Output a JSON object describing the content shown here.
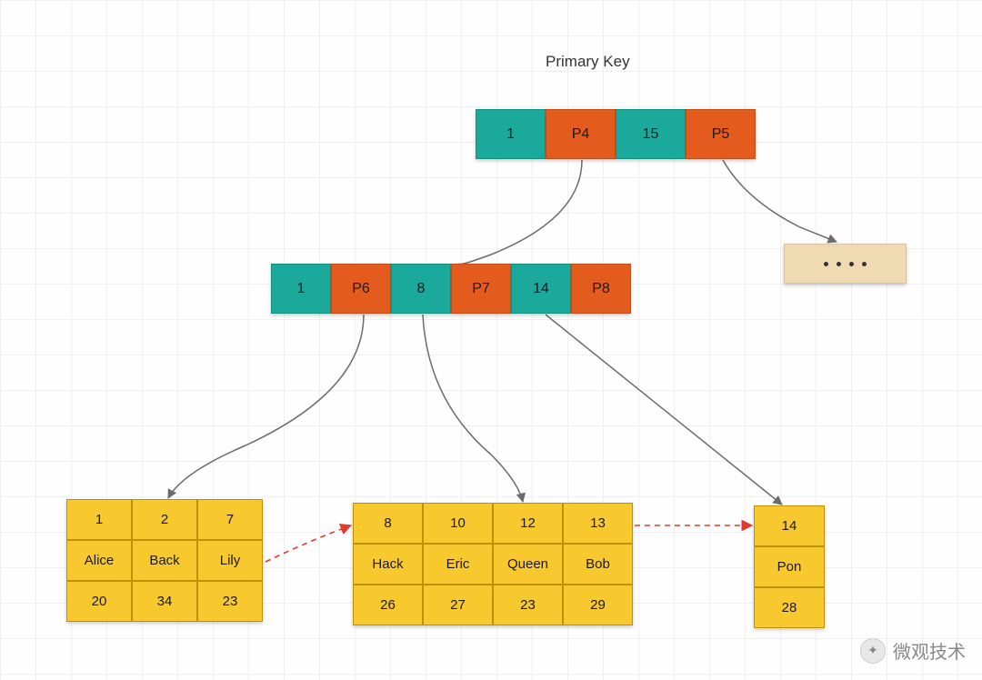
{
  "title": "Primary Key",
  "colors": {
    "teal": "#1aa99a",
    "orange": "#e45b1e",
    "yellow": "#f7c92f",
    "tan": "#f0dab2",
    "arrow_solid": "#6b6b6b",
    "arrow_dashed": "#e03a2a"
  },
  "root_node": {
    "cells": [
      {
        "value": "1",
        "color": "teal"
      },
      {
        "value": "P4",
        "color": "orange"
      },
      {
        "value": "15",
        "color": "teal"
      },
      {
        "value": "P5",
        "color": "orange"
      }
    ]
  },
  "internal_node": {
    "cells": [
      {
        "value": "1",
        "color": "teal"
      },
      {
        "value": "P6",
        "color": "orange"
      },
      {
        "value": "8",
        "color": "teal"
      },
      {
        "value": "P7",
        "color": "orange"
      },
      {
        "value": "14",
        "color": "teal"
      },
      {
        "value": "P8",
        "color": "orange"
      }
    ]
  },
  "ellipsis_box": {
    "dot_count": 4,
    "color": "tan"
  },
  "leaves": [
    {
      "id": "leaf1",
      "columns": 3,
      "rows": [
        [
          "1",
          "2",
          "7"
        ],
        [
          "Alice",
          "Back",
          "Lily"
        ],
        [
          "20",
          "34",
          "23"
        ]
      ]
    },
    {
      "id": "leaf2",
      "columns": 4,
      "rows": [
        [
          "8",
          "10",
          "12",
          "13"
        ],
        [
          "Hack",
          "Eric",
          "Queen",
          "Bob"
        ],
        [
          "26",
          "27",
          "23",
          "29"
        ]
      ]
    },
    {
      "id": "leaf3",
      "columns": 1,
      "rows": [
        [
          "14"
        ],
        [
          "Pon"
        ],
        [
          "28"
        ]
      ]
    }
  ],
  "watermark": {
    "text": "微观技术"
  }
}
